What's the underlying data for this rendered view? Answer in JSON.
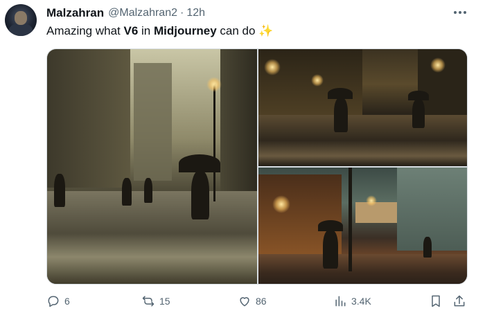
{
  "author": {
    "name": "Malzahran",
    "handle": "@Malzahran2",
    "separator": "·",
    "time": "12h"
  },
  "tweet": {
    "text_before": "Amazing what ",
    "bold_1": "V6",
    "text_middle": " in ",
    "bold_2": "Midjourney",
    "text_after": " can do ",
    "emoji": "✨"
  },
  "media": {
    "images": [
      {
        "icon": "rainy-street-image"
      },
      {
        "icon": "rainy-street-image"
      },
      {
        "icon": "rainy-street-image"
      }
    ]
  },
  "actions": {
    "reply_count": "6",
    "repost_count": "15",
    "like_count": "86",
    "views_count": "3.4K"
  },
  "icons": {
    "more": "more-options-icon",
    "reply": "reply-icon",
    "repost": "repost-icon",
    "like": "heart-icon",
    "views": "views-icon",
    "bookmark": "bookmark-icon",
    "share": "share-icon"
  },
  "colors": {
    "text": "#0f1419",
    "secondary": "#536471",
    "sparkle": "#f4b400"
  }
}
